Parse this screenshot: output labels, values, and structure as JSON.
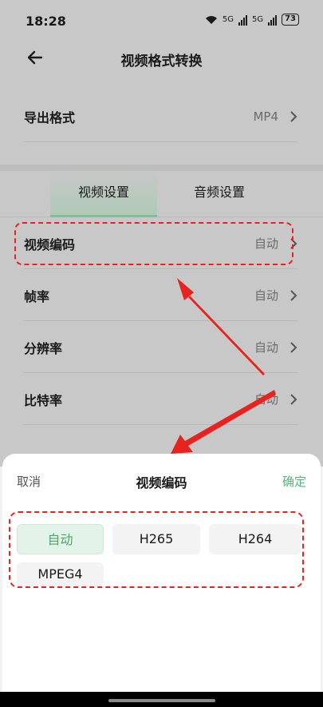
{
  "status_bar": {
    "time": "18:28",
    "network_label": "5G",
    "battery": "73"
  },
  "header": {
    "title": "视频格式转换"
  },
  "export": {
    "label": "导出格式",
    "value": "MP4"
  },
  "tabs": [
    {
      "label": "视频设置"
    },
    {
      "label": "音频设置"
    }
  ],
  "settings": [
    {
      "label": "视频编码",
      "value": "自动"
    },
    {
      "label": "帧率",
      "value": "自动"
    },
    {
      "label": "分辨率",
      "value": "自动"
    },
    {
      "label": "比特率",
      "value": "自动"
    }
  ],
  "sheet": {
    "cancel": "取消",
    "title": "视频编码",
    "confirm": "确定",
    "options": [
      {
        "label": "自动",
        "selected": true
      },
      {
        "label": "H265",
        "selected": false
      },
      {
        "label": "H264",
        "selected": false
      },
      {
        "label": "MPEG4",
        "selected": false
      }
    ]
  },
  "colors": {
    "accent": "#5fb07c",
    "annotation": "#e8231f"
  }
}
